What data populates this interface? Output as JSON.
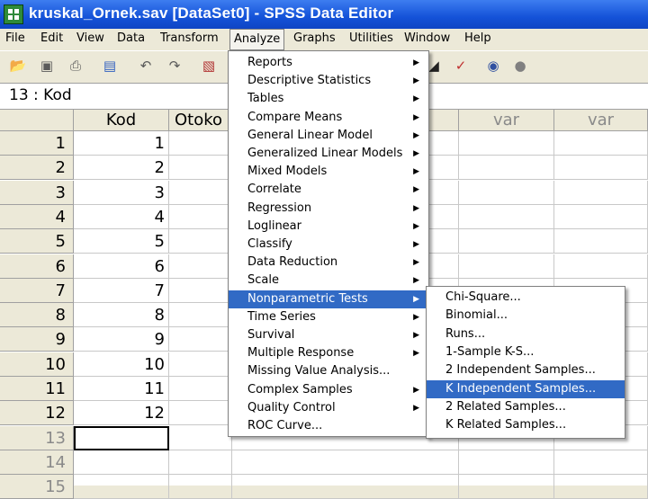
{
  "window": {
    "title": "kruskal_Ornek.sav [DataSet0] - SPSS Data Editor"
  },
  "menubar": [
    "File",
    "Edit",
    "View",
    "Data",
    "Transform",
    "Analyze",
    "Graphs",
    "Utilities",
    "Window",
    "Help"
  ],
  "cell_reference": "13 : Kod",
  "columns": [
    "Kod",
    "Otoko",
    "var",
    "var"
  ],
  "rows": [
    {
      "num": "1",
      "kod": "1"
    },
    {
      "num": "2",
      "kod": "2"
    },
    {
      "num": "3",
      "kod": "3"
    },
    {
      "num": "4",
      "kod": "4"
    },
    {
      "num": "5",
      "kod": "5"
    },
    {
      "num": "6",
      "kod": "6"
    },
    {
      "num": "7",
      "kod": "7"
    },
    {
      "num": "8",
      "kod": "8"
    },
    {
      "num": "9",
      "kod": "9"
    },
    {
      "num": "10",
      "kod": "10"
    },
    {
      "num": "11",
      "kod": "11"
    },
    {
      "num": "12",
      "kod": "12"
    },
    {
      "num": "13",
      "kod": ""
    },
    {
      "num": "14",
      "kod": ""
    },
    {
      "num": "15",
      "kod": ""
    }
  ],
  "analyze_menu": [
    {
      "label": "Reports",
      "submenu": true
    },
    {
      "label": "Descriptive Statistics",
      "submenu": true
    },
    {
      "label": "Tables",
      "submenu": true
    },
    {
      "label": "Compare Means",
      "submenu": true
    },
    {
      "label": "General Linear Model",
      "submenu": true
    },
    {
      "label": "Generalized Linear Models",
      "submenu": true
    },
    {
      "label": "Mixed Models",
      "submenu": true
    },
    {
      "label": "Correlate",
      "submenu": true
    },
    {
      "label": "Regression",
      "submenu": true
    },
    {
      "label": "Loglinear",
      "submenu": true
    },
    {
      "label": "Classify",
      "submenu": true
    },
    {
      "label": "Data Reduction",
      "submenu": true
    },
    {
      "label": "Scale",
      "submenu": true
    },
    {
      "label": "Nonparametric Tests",
      "submenu": true,
      "highlighted": true
    },
    {
      "label": "Time Series",
      "submenu": true
    },
    {
      "label": "Survival",
      "submenu": true
    },
    {
      "label": "Multiple Response",
      "submenu": true
    },
    {
      "label": "Missing Value Analysis...",
      "submenu": false
    },
    {
      "label": "Complex Samples",
      "submenu": true
    },
    {
      "label": "Quality Control",
      "submenu": true
    },
    {
      "label": "ROC Curve...",
      "submenu": false
    }
  ],
  "nonparametric_submenu": [
    {
      "label": "Chi-Square..."
    },
    {
      "label": "Binomial..."
    },
    {
      "label": "Runs..."
    },
    {
      "label": "1-Sample K-S..."
    },
    {
      "label": "2 Independent Samples..."
    },
    {
      "label": "K Independent Samples...",
      "highlighted": true
    },
    {
      "label": "2 Related Samples..."
    },
    {
      "label": "K Related Samples..."
    }
  ],
  "toolbar_icons": [
    "open-icon",
    "save-icon",
    "print-icon",
    "dialog-recall-icon",
    "undo-icon",
    "redo-icon",
    "goto-case-icon",
    "find-icon",
    "value-labels-icon",
    "use-sets-icon",
    "show-sets-icon"
  ],
  "colors": {
    "highlight": "#316ac5",
    "titlebar": "#1452d8"
  }
}
